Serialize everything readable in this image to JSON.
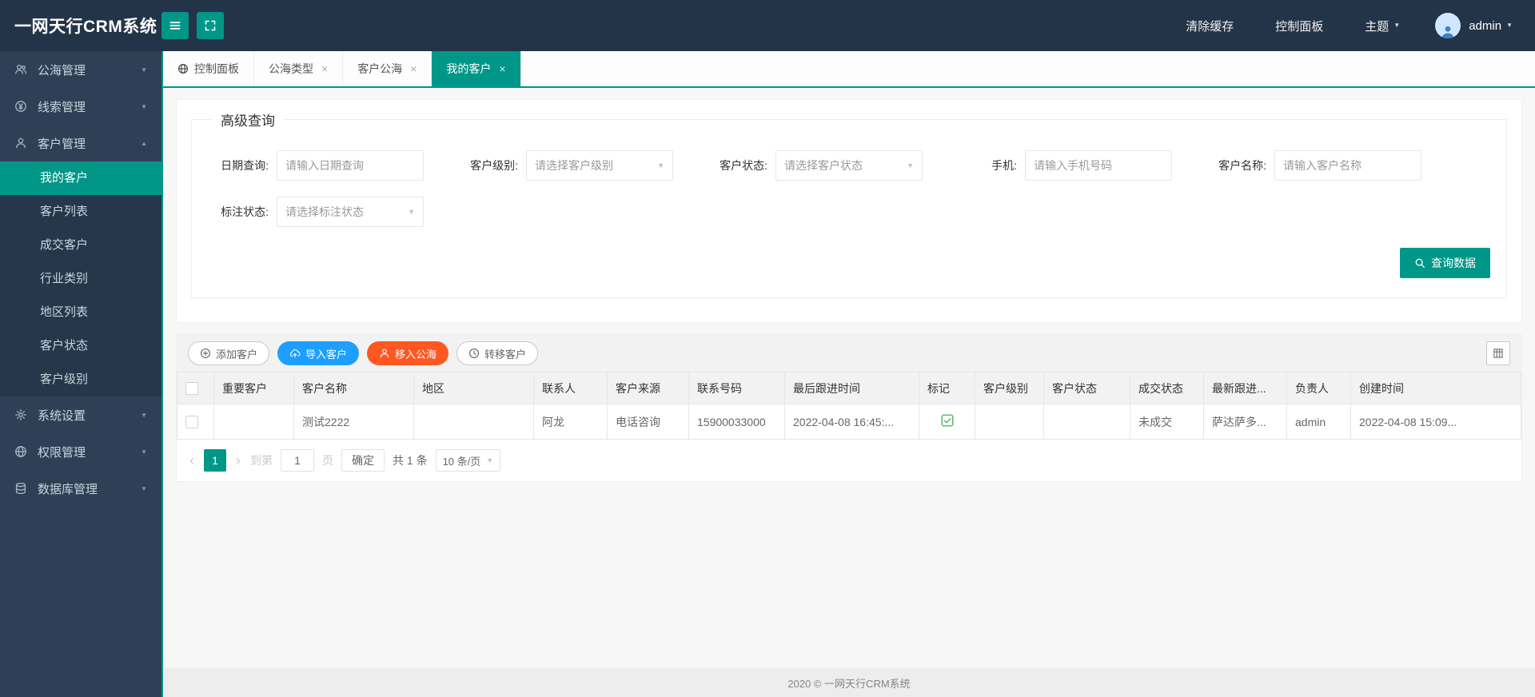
{
  "colors": {
    "accent": "#009688",
    "blue": "#1E9FFF",
    "red": "#FF5722",
    "mark_green": "#5FB878",
    "topbar_bg": "#243448",
    "sidebar_bg": "#2f4056"
  },
  "icons": {
    "caret_down": "▼",
    "caret_up": "▲",
    "close": "×"
  },
  "header": {
    "logo": "一网天行CRM系统",
    "clear_cache": "清除缓存",
    "control_panel": "控制面板",
    "theme": "主题",
    "username": "admin"
  },
  "sidebar": {
    "items": [
      {
        "label": "公海管理"
      },
      {
        "label": "线索管理"
      },
      {
        "label": "客户管理"
      },
      {
        "label": "系统设置"
      },
      {
        "label": "权限管理"
      },
      {
        "label": "数据库管理"
      }
    ],
    "customer_children": [
      "我的客户",
      "客户列表",
      "成交客户",
      "行业类别",
      "地区列表",
      "客户状态",
      "客户级别"
    ],
    "active_item": "我的客户"
  },
  "tabs": {
    "items": [
      {
        "label": "控制面板"
      },
      {
        "label": "公海类型"
      },
      {
        "label": "客户公海"
      },
      {
        "label": "我的客户"
      }
    ]
  },
  "query": {
    "legend": "高级查询",
    "fields": [
      {
        "label": "日期查询:",
        "placeholder": "请输入日期查询"
      },
      {
        "label": "客户级别:",
        "placeholder": "请选择客户级别"
      },
      {
        "label": "客户状态:",
        "placeholder": "请选择客户状态"
      },
      {
        "label": "手机:",
        "placeholder": "请输入手机号码"
      },
      {
        "label": "客户名称:",
        "placeholder": "请输入客户名称"
      },
      {
        "label": "标注状态:",
        "placeholder": "请选择标注状态"
      }
    ],
    "search_button": "查询数据"
  },
  "toolbar": {
    "add": "添加客户",
    "import": "导入客户",
    "move_to_sea": "移入公海",
    "transfer": "转移客户"
  },
  "table": {
    "columns": [
      "重要客户",
      "客户名称",
      "地区",
      "联系人",
      "客户来源",
      "联系号码",
      "最后跟进时间",
      "标记",
      "客户级别",
      "客户状态",
      "成交状态",
      "最新跟进...",
      "负责人",
      "创建时间"
    ],
    "rows": [
      {
        "cells": [
          "",
          "测试2222",
          "",
          "阿龙",
          "电话咨询",
          "15900033000",
          "2022-04-08 16:45:...",
          "",
          "",
          "",
          "未成交",
          "萨达萨多...",
          "admin",
          "2022-04-08 15:09..."
        ],
        "mark": "check-square"
      }
    ]
  },
  "pagination": {
    "prev": "‹",
    "next": "›",
    "current_page": "1",
    "goto_prefix": "到第",
    "goto_value": "1",
    "goto_suffix": "页",
    "confirm": "确定",
    "total": "共 1 条",
    "page_size": "10 条/页"
  },
  "footer": {
    "text": "2020 ©   一网天行CRM系统"
  }
}
